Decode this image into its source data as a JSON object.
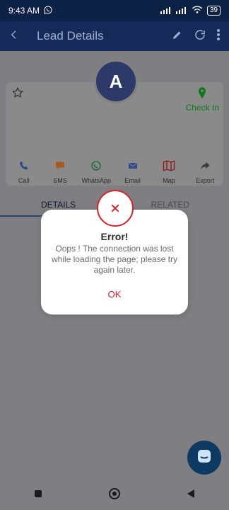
{
  "status_bar": {
    "time": "9:43 AM",
    "battery": "39"
  },
  "app_bar": {
    "title": "Lead Details"
  },
  "lead": {
    "avatar_letter": "A",
    "checkin_label": "Check In"
  },
  "actions": [
    {
      "label": "Call"
    },
    {
      "label": "SMS"
    },
    {
      "label": "WhatsApp"
    },
    {
      "label": "Email"
    },
    {
      "label": "Map"
    },
    {
      "label": "Export"
    }
  ],
  "tabs": [
    {
      "label": "DETAILS"
    },
    {
      "label": "RELATED"
    }
  ],
  "dialog": {
    "title": "Error!",
    "message": "Oops ! The connection was lost while loading the page; please try again later.",
    "ok_label": "OK"
  }
}
